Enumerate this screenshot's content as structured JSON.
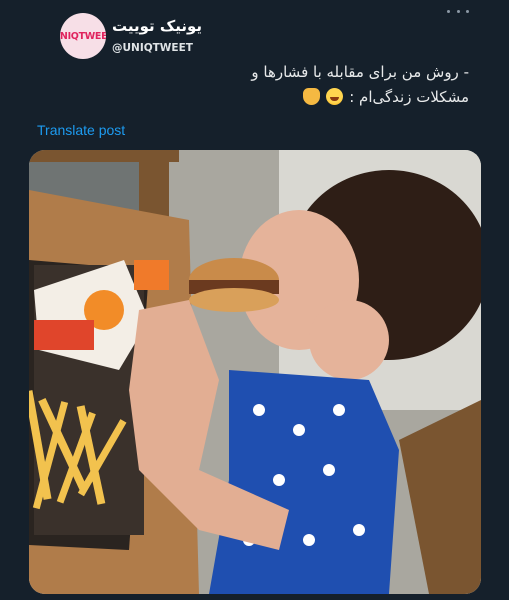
{
  "account": {
    "avatar_text": "UNIQTWEET",
    "display_name": "یونیک توییت",
    "handle": "@UNIQTWEET"
  },
  "more_icon": "more-horizontal-icon",
  "tweet": {
    "line1": "- روش من برای مقابله با فشارها و",
    "line2": "مشکلات زندگی‌ام :",
    "emojis": [
      "laughing-with-tears-emoji",
      "pointing-down-emoji"
    ]
  },
  "translate": {
    "label": "Translate post"
  },
  "media": {
    "description_icon": "photo-girl-eating-burger"
  },
  "colors": {
    "background": "#15202b",
    "link": "#1d9bf0",
    "text": "#e7e9ea"
  }
}
